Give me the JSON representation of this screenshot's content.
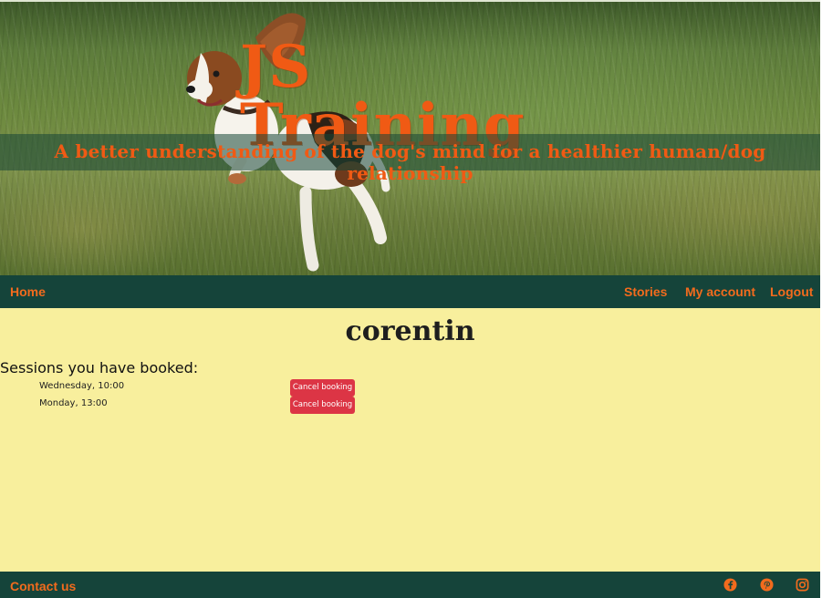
{
  "hero": {
    "title": "JS Training",
    "tagline": "A better understanding of the dog's mind for a healthier human/dog relationship"
  },
  "nav": {
    "home": "Home",
    "stories": "Stories",
    "account": "My account",
    "logout": "Logout"
  },
  "profile": {
    "username": "corentin",
    "sessions_heading": "Sessions you have booked:",
    "sessions": [
      {
        "time": "Wednesday, 10:00",
        "action": "Cancel booking"
      },
      {
        "time": "Monday, 13:00",
        "action": "Cancel booking"
      }
    ]
  },
  "footer": {
    "contact": "Contact us",
    "social_icons": [
      "facebook-icon",
      "pinterest-icon",
      "instagram-icon"
    ]
  },
  "colors": {
    "brand_orange": "#f05a14",
    "nav_green": "#15443a",
    "main_bg": "#f8ef9d",
    "danger": "#dc3545"
  }
}
